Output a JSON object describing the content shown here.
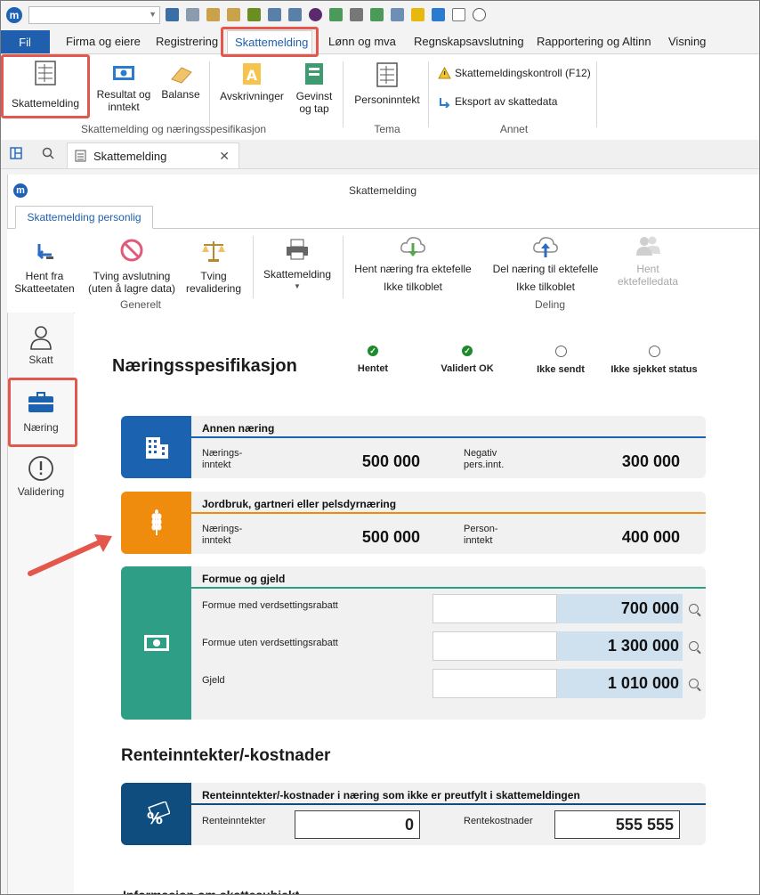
{
  "menu": {
    "file": "Fil",
    "tabs": [
      "Firma og eiere",
      "Registrering",
      "Skattemelding",
      "Lønn og mva",
      "Regnskapsavslutning",
      "Rapportering og Altinn",
      "Visning"
    ]
  },
  "ribbon": {
    "buttons": {
      "skattemelding": "Skattemelding",
      "resultat": "Resultat og inntekt",
      "balanse": "Balanse",
      "avskrivninger": "Avskrivninger",
      "gevinst": "Gevinst og tap",
      "personinntekt": "Personinntekt",
      "kontroll": "Skattemeldingskontroll (F12)",
      "eksport": "Eksport av skattedata"
    },
    "groups": {
      "main": "Skattemelding og næringsspesifikasjon",
      "tema": "Tema",
      "annet": "Annet"
    }
  },
  "doc_tab": {
    "label": "Skattemelding"
  },
  "inner": {
    "title": "Skattemelding",
    "tab": "Skattemelding personlig",
    "buttons": {
      "hent": "Hent fra Skatteetaten",
      "tving": "Tving avslutning (uten å lagre data)",
      "revalidering": "Tving revalidering",
      "skattemelding": "Skattemelding",
      "hent_naering": "Hent næring fra ektefelle",
      "hent_status": "Ikke tilkoblet",
      "del_naering": "Del næring til ektefelle",
      "del_status": "Ikke tilkoblet",
      "hent_ektefelle": "Hent ektefelledata"
    },
    "groups": {
      "generelt": "Generelt",
      "deling": "Deling"
    }
  },
  "sidenav": {
    "skatt": "Skatt",
    "naering": "Næring",
    "validering": "Validering"
  },
  "page": {
    "title": "Næringsspesifikasjon",
    "statuses": [
      {
        "label": "Hentet",
        "state": "ok"
      },
      {
        "label": "Validert OK",
        "state": "ok"
      },
      {
        "label": "Ikke sendt",
        "state": "empty"
      },
      {
        "label": "Ikke sjekket status",
        "state": "empty"
      }
    ],
    "cards": {
      "annen": {
        "title": "Annen næring",
        "label1": "Nærings-\ninntekt",
        "value1": "500 000",
        "label2": "Negativ\npers.innt.",
        "value2": "300 000",
        "color": "#1b63b0"
      },
      "jordbruk": {
        "title": "Jordbruk, gartneri eller pelsdyrnæring",
        "label1": "Nærings-\ninntekt",
        "value1": "500 000",
        "label2": "Person-\ninntekt",
        "value2": "400 000",
        "color": "#ef8c0e"
      },
      "formue": {
        "title": "Formue og gjeld",
        "rows": [
          {
            "label": "Formue med verdsettingsrabatt",
            "value": "700 000"
          },
          {
            "label": "Formue uten verdsettingsrabatt",
            "value": "1 300 000"
          },
          {
            "label": "Gjeld",
            "value": "1 010 000"
          }
        ],
        "color": "#2e9e86"
      }
    },
    "rente": {
      "heading": "Renteinntekter/-kostnader",
      "card_title": "Renteinntekter/-kostnader i næring som ikke er preutfylt i skattemeldingen",
      "label1": "Renteinntekter",
      "value1": "0",
      "label2": "Rentekostnader",
      "value2": "555 555",
      "color": "#0f4d7e"
    },
    "footer_cut": "Informasjon om skattesubjekt"
  }
}
